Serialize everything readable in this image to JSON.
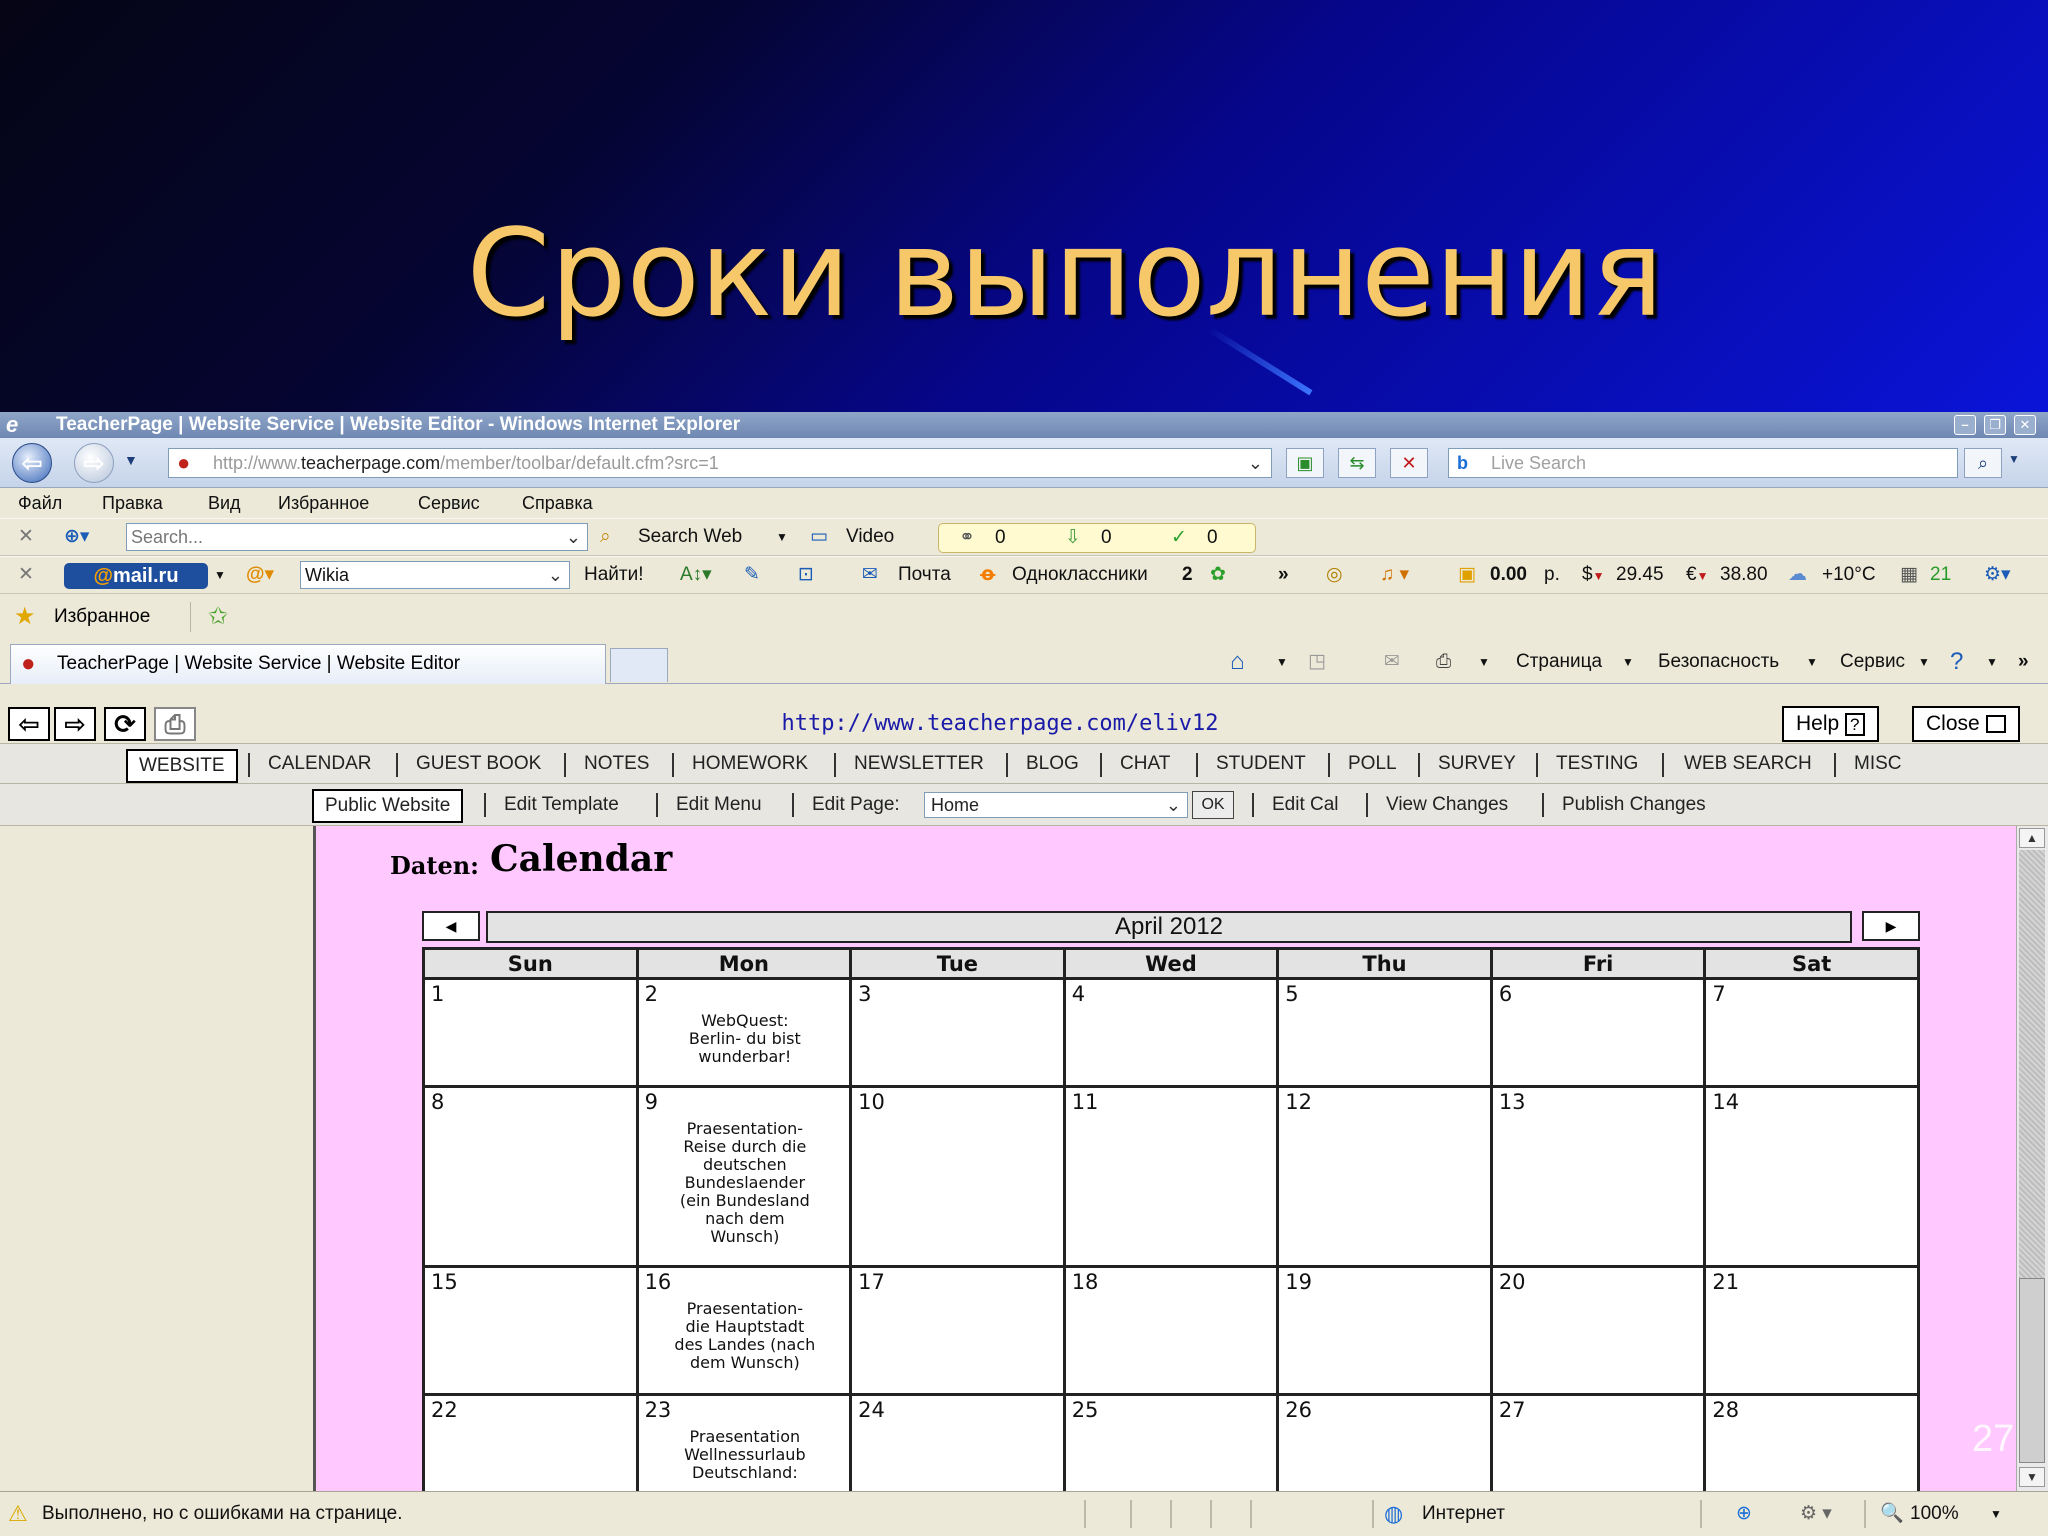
{
  "slide": {
    "title": "Сроки выполнения",
    "number": "27"
  },
  "window": {
    "title": "TeacherPage | Website Service | Website Editor - Windows Internet Explorer"
  },
  "address": {
    "url_prefix": "http://www.",
    "url_domain": "teacherpage.com",
    "url_path": "/member/toolbar/default.cfm?src=1",
    "live_search_placeholder": "Live Search"
  },
  "menubar": [
    "Файл",
    "Правка",
    "Вид",
    "Избранное",
    "Сервис",
    "Справка"
  ],
  "toolbar1": {
    "search_placeholder": "Search...",
    "search_web": "Search Web",
    "video": "Video",
    "counters": [
      "0",
      "0",
      "0"
    ]
  },
  "toolbar2": {
    "mailru_at": "@",
    "mailru_text": "mail.ru",
    "search_value": "Wikia",
    "find_button": "Найти!",
    "mail_link": "Почта",
    "odnoklassniki": "Одноклассники",
    "odnoklassniki_count": "2",
    "balance": "0.00",
    "balance_unit": "р.",
    "usd": "29.45",
    "eur": "38.80",
    "weather": "+10°C",
    "traffic": "21"
  },
  "favorites": {
    "label": "Избранное"
  },
  "tabs": {
    "active_tab": "TeacherPage | Website Service | Website Editor",
    "commands": [
      "Страница",
      "Безопасность",
      "Сервис"
    ]
  },
  "teacherpage": {
    "url": "http://www.teacherpage.com/eliv12",
    "help": "Help",
    "close": "Close",
    "main_nav": [
      "WEBSITE",
      "CALENDAR",
      "GUEST BOOK",
      "NOTES",
      "HOMEWORK",
      "NEWSLETTER",
      "BLOG",
      "CHAT",
      "STUDENT",
      "POLL",
      "SURVEY",
      "TESTING",
      "WEB SEARCH",
      "MISC"
    ],
    "sub_nav": {
      "public_website": "Public Website",
      "edit_template": "Edit Template",
      "edit_menu": "Edit Menu",
      "edit_page_label": "Edit Page:",
      "edit_page_value": "Home",
      "ok": "OK",
      "edit_cal": "Edit Cal",
      "view_changes": "View Changes",
      "publish_changes": "Publish Changes"
    }
  },
  "calendar": {
    "label": "Daten:",
    "heading": "Calendar",
    "month": "April 2012",
    "weekdays": [
      "Sun",
      "Mon",
      "Tue",
      "Wed",
      "Thu",
      "Fri",
      "Sat"
    ],
    "weeks": [
      [
        {
          "day": "1",
          "event": ""
        },
        {
          "day": "2",
          "event": "WebQuest:\nBerlin- du bist\nwunderbar!"
        },
        {
          "day": "3",
          "event": ""
        },
        {
          "day": "4",
          "event": ""
        },
        {
          "day": "5",
          "event": ""
        },
        {
          "day": "6",
          "event": ""
        },
        {
          "day": "7",
          "event": ""
        }
      ],
      [
        {
          "day": "8",
          "event": ""
        },
        {
          "day": "9",
          "event": "Praesentation-\nReise durch die\ndeutschen\nBundeslaender\n(ein Bundesland\nnach dem\nWunsch)"
        },
        {
          "day": "10",
          "event": ""
        },
        {
          "day": "11",
          "event": ""
        },
        {
          "day": "12",
          "event": ""
        },
        {
          "day": "13",
          "event": ""
        },
        {
          "day": "14",
          "event": ""
        }
      ],
      [
        {
          "day": "15",
          "event": ""
        },
        {
          "day": "16",
          "event": "Praesentation-\ndie Hauptstadt\ndes Landes (nach\ndem Wunsch)"
        },
        {
          "day": "17",
          "event": ""
        },
        {
          "day": "18",
          "event": ""
        },
        {
          "day": "19",
          "event": ""
        },
        {
          "day": "20",
          "event": ""
        },
        {
          "day": "21",
          "event": ""
        }
      ],
      [
        {
          "day": "22",
          "event": ""
        },
        {
          "day": "23",
          "event": "Praesentation\nWellnessurlaub\nDeutschland:"
        },
        {
          "day": "24",
          "event": ""
        },
        {
          "day": "25",
          "event": ""
        },
        {
          "day": "26",
          "event": ""
        },
        {
          "day": "27",
          "event": ""
        },
        {
          "day": "28",
          "event": ""
        }
      ]
    ]
  },
  "status": {
    "message": "Выполнено, но с ошибками на странице.",
    "zone": "Интернет",
    "zoom": "100%"
  }
}
